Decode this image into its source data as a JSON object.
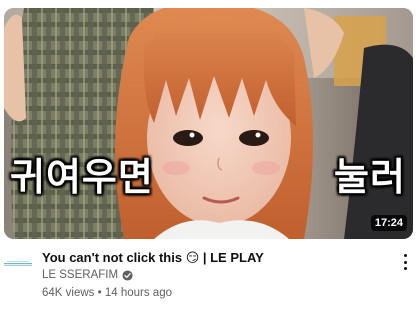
{
  "video": {
    "overlay_left": "귀여우면",
    "overlay_right": "눌러",
    "duration": "17:24",
    "title": "You can't not click this 😏 | LE PLAY",
    "channel": "LE SSERAFIM",
    "views": "64K views",
    "separator": "•",
    "age": "14 hours ago"
  },
  "icons": {
    "verified": "verified-check-icon",
    "more": "more-vertical-icon",
    "avatar": "channel-logo-icon"
  },
  "colors": {
    "hair": "#d2713c",
    "title_text": "#0f0f0f",
    "secondary_text": "#606060"
  }
}
